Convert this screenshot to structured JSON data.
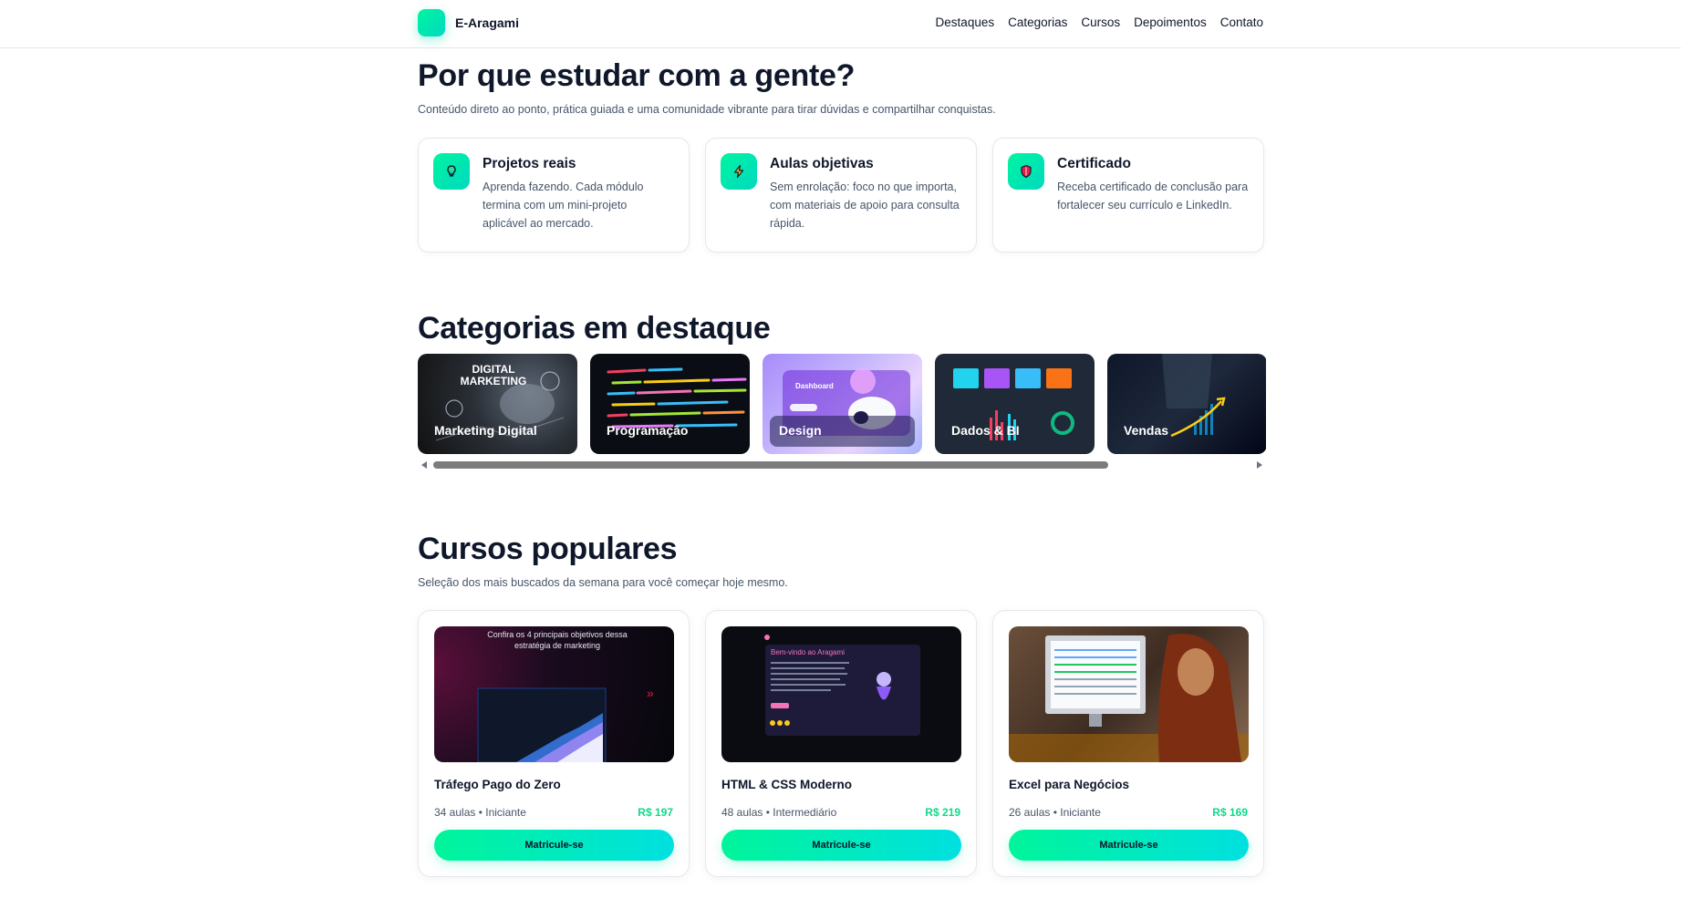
{
  "header": {
    "brand": "E-Aragami",
    "nav": [
      "Destaques",
      "Categorias",
      "Cursos",
      "Depoimentos",
      "Contato"
    ]
  },
  "why": {
    "title": "Por que estudar com a gente?",
    "subtitle": "Conteúdo direto ao ponto, prática guiada e uma comunidade vibrante para tirar dúvidas e compartilhar conquistas.",
    "features": [
      {
        "icon": "lightbulb-icon",
        "title": "Projetos reais",
        "desc": "Aprenda fazendo. Cada módulo termina com um mini-projeto aplicável ao mercado."
      },
      {
        "icon": "lightning-icon",
        "title": "Aulas objetivas",
        "desc": "Sem enrolação: foco no que importa, com materiais de apoio para consulta rápida."
      },
      {
        "icon": "shield-icon",
        "title": "Certificado",
        "desc": "Receba certificado de conclusão para fortalecer seu currículo e LinkedIn."
      }
    ]
  },
  "categories": {
    "title": "Categorias em destaque",
    "items": [
      {
        "label": "Marketing Digital",
        "image_text": "DIGITAL MARKETING"
      },
      {
        "label": "Programação"
      },
      {
        "label": "Design",
        "image_text": "Dashboard"
      },
      {
        "label": "Dados & BI"
      },
      {
        "label": "Vendas"
      }
    ]
  },
  "courses": {
    "title": "Cursos populares",
    "subtitle": "Seleção dos mais buscados da semana para você começar hoje mesmo.",
    "items": [
      {
        "title": "Tráfego Pago do Zero",
        "info": "34 aulas • Iniciante",
        "price": "R$ 197",
        "cta": "Matricule-se",
        "thumb_text": "Confira os 4 principais objetivos dessa estratégia de marketing"
      },
      {
        "title": "HTML & CSS Moderno",
        "info": "48 aulas • Intermediário",
        "price": "R$ 219",
        "cta": "Matricule-se",
        "thumb_text": "Bem-vindo ao Aragami"
      },
      {
        "title": "Excel para Negócios",
        "info": "26 aulas • Iniciante",
        "price": "R$ 169",
        "cta": "Matricule-se"
      }
    ]
  },
  "colors": {
    "accent": "#00f5a0",
    "accent2": "#00d9e0",
    "price": "#10d98a",
    "text": "#0f172a",
    "muted": "#475569"
  }
}
